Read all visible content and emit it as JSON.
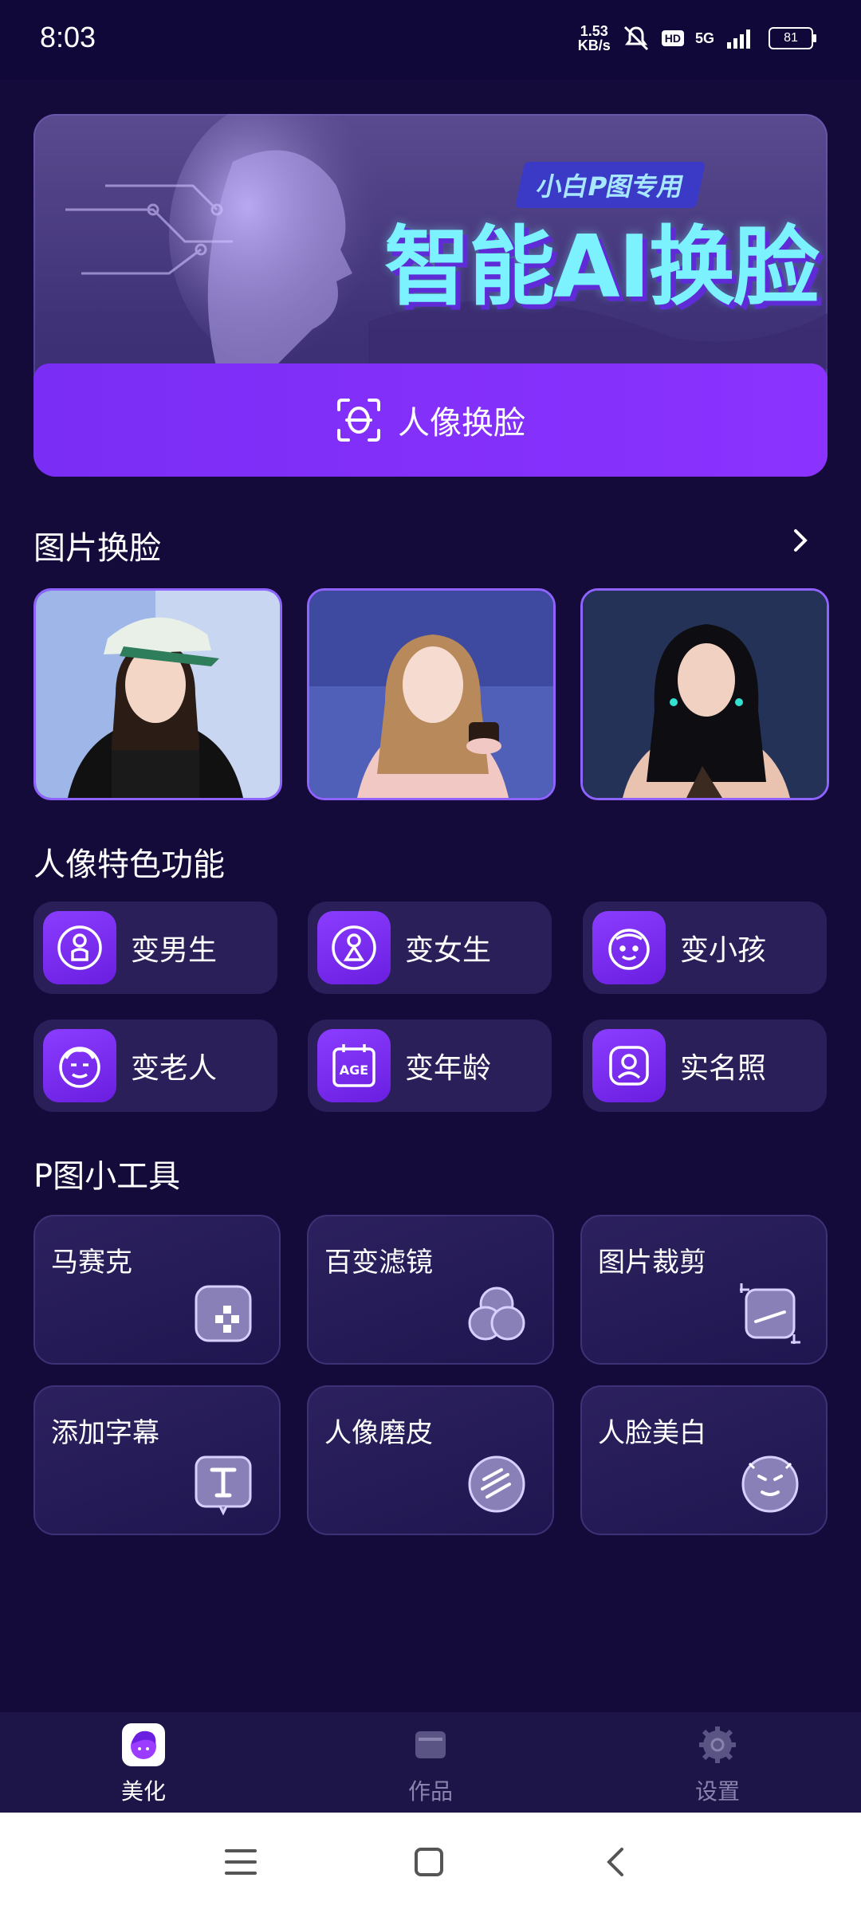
{
  "status": {
    "time": "8:03",
    "speed_value": "1.53",
    "speed_unit": "KB/s",
    "hd": "HD",
    "network": "5G",
    "battery": "81"
  },
  "banner": {
    "tag": "小白P图专用",
    "title": "智能AI换脸",
    "button_label": "人像换脸"
  },
  "section_photo": {
    "title": "图片换脸"
  },
  "section_features": {
    "title": "人像特色功能",
    "items": [
      {
        "label": "变男生",
        "icon": "male-icon"
      },
      {
        "label": "变女生",
        "icon": "female-icon"
      },
      {
        "label": "变小孩",
        "icon": "child-face-icon"
      },
      {
        "label": "变老人",
        "icon": "elder-face-icon"
      },
      {
        "label": "变年龄",
        "icon": "age-calendar-icon"
      },
      {
        "label": "实名照",
        "icon": "id-photo-icon"
      }
    ]
  },
  "section_tools": {
    "title": "P图小工具",
    "items": [
      {
        "label": "马赛克",
        "icon": "mosaic-icon"
      },
      {
        "label": "百变滤镜",
        "icon": "filter-icon"
      },
      {
        "label": "图片裁剪",
        "icon": "crop-icon"
      },
      {
        "label": "添加字幕",
        "icon": "text-icon"
      },
      {
        "label": "人像磨皮",
        "icon": "smooth-skin-icon"
      },
      {
        "label": "人脸美白",
        "icon": "whitening-icon"
      }
    ]
  },
  "tabs": [
    {
      "label": "美化",
      "active": true
    },
    {
      "label": "作品",
      "active": false
    },
    {
      "label": "设置",
      "active": false
    }
  ],
  "colors": {
    "background": "#140b3a",
    "accent": "#8b32ff",
    "accent_light": "#7cf2ff"
  }
}
